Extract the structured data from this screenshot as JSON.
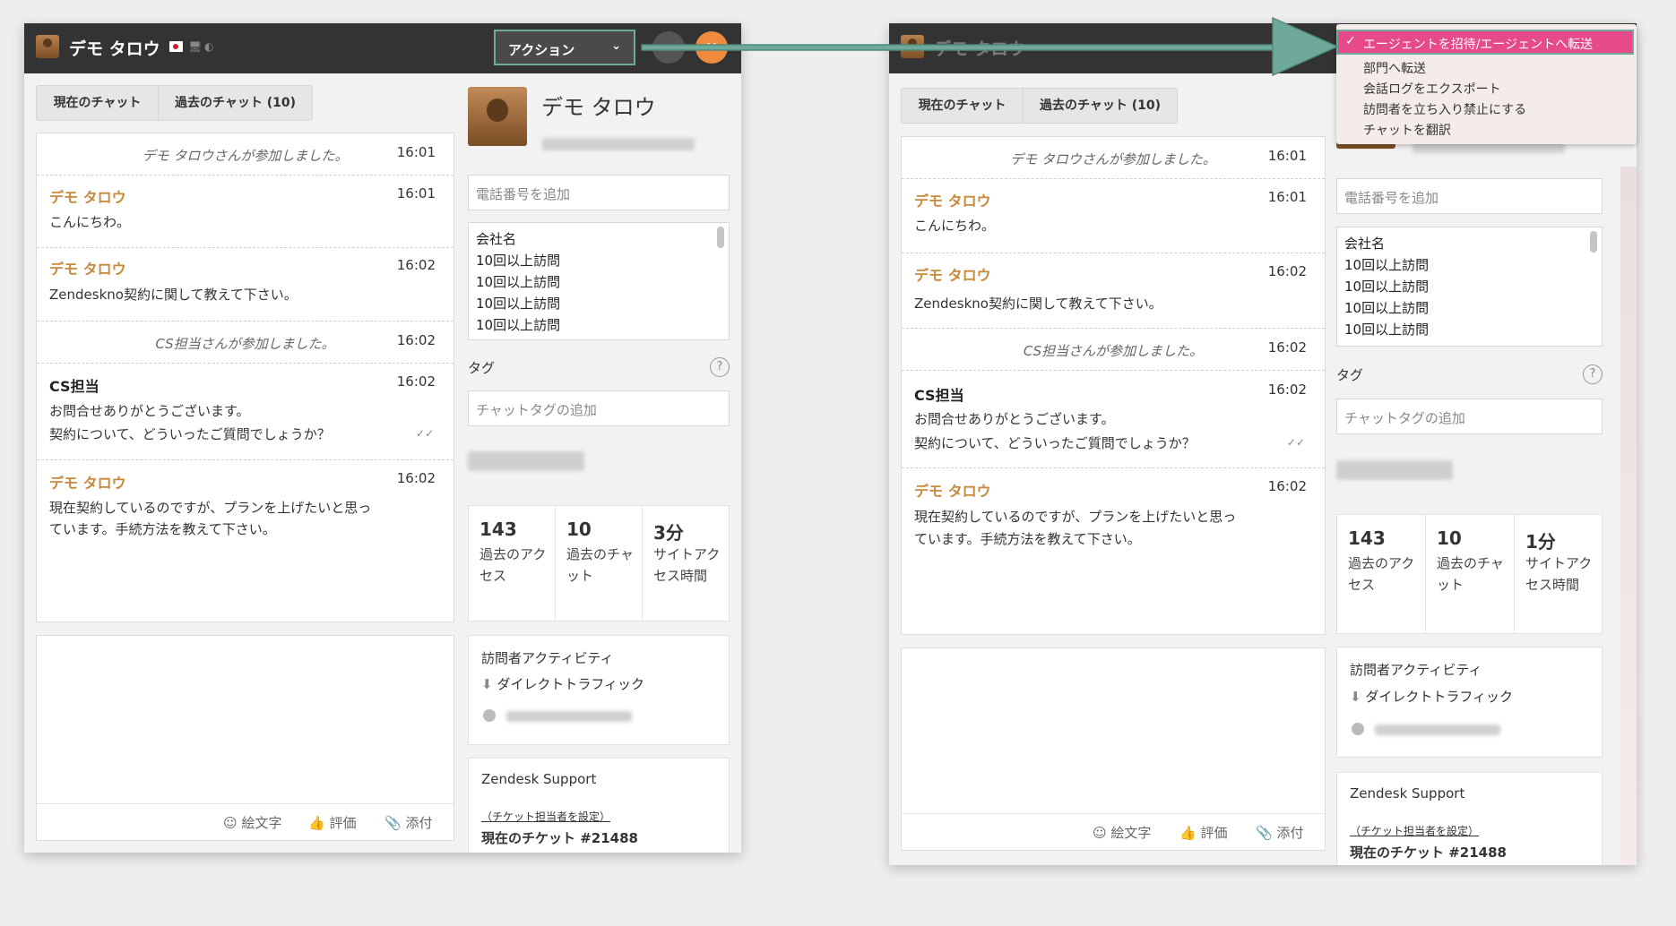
{
  "visitor_name": "デモ タロウ",
  "action_label": "アクション",
  "tabs": {
    "current": "現在のチャット",
    "past": "過去のチャット (10)"
  },
  "messages": {
    "m1_text": "デモ タロウさんが参加しました。",
    "m1_time": "16:01",
    "m2_sender": "デモ タロウ",
    "m2_time": "16:01",
    "m2_text": "こんにちわ。",
    "m3_sender": "デモ タロウ",
    "m3_time": "16:02",
    "m3_text": "Zendeskno契約に関して教えて下さい。",
    "m4_text": "CS担当さんが参加しました。",
    "m4_time": "16:02",
    "m5_sender": "CS担当",
    "m5_time": "16:02",
    "m5_line1": "お問合せありがとうございます。",
    "m5_line2": "契約について、どういったご質問でしょうか？",
    "m6_sender": "デモ タロウ",
    "m6_time": "16:02",
    "m6_line1": "現在契約しているのですが、プランを上げたいと思っ",
    "m6_line2": "ています。手続方法を教えて下さい。"
  },
  "toolbar": {
    "emoji": "絵文字",
    "rate": "評価",
    "attach": "添付"
  },
  "right_panel": {
    "phone_placeholder": "電話番号を追加",
    "notes": [
      "会社名",
      "10回以上訪問",
      "10回以上訪問",
      "10回以上訪問",
      "10回以上訪問"
    ],
    "tag_label": "タグ",
    "tag_placeholder": "チャットタグの追加",
    "stats": [
      {
        "num": "143",
        "cap": "過去のアクセス"
      },
      {
        "num": "10",
        "cap": "過去のチャット"
      },
      {
        "num": "3分",
        "cap": "サイトアクセス時間"
      }
    ],
    "stats_b": [
      {
        "num": "143",
        "cap": "過去のアクセス"
      },
      {
        "num": "10",
        "cap": "過去のチャット"
      },
      {
        "num": "1分",
        "cap": "サイトアクセス時間"
      }
    ],
    "activity_title": "訪問者アクティビティ",
    "traffic": "ダイレクトトラフィック",
    "zendesk_title": "Zendesk Support",
    "assign_link": "（チケット担当者を設定）",
    "current_ticket": "現在のチケット #21488"
  },
  "dropdown": {
    "selected": "エージェントを招待/エージェントへ転送",
    "items": [
      "部門へ転送",
      "会話ログをエクスポート",
      "訪問者を立ち入り禁止にする",
      "チャットを翻訳"
    ]
  },
  "colors": {
    "accent_orange": "#f08a3c",
    "highlight_teal": "#6fa99a",
    "menu_selected": "#e64a8a",
    "visitor_name": "#c8893c"
  }
}
